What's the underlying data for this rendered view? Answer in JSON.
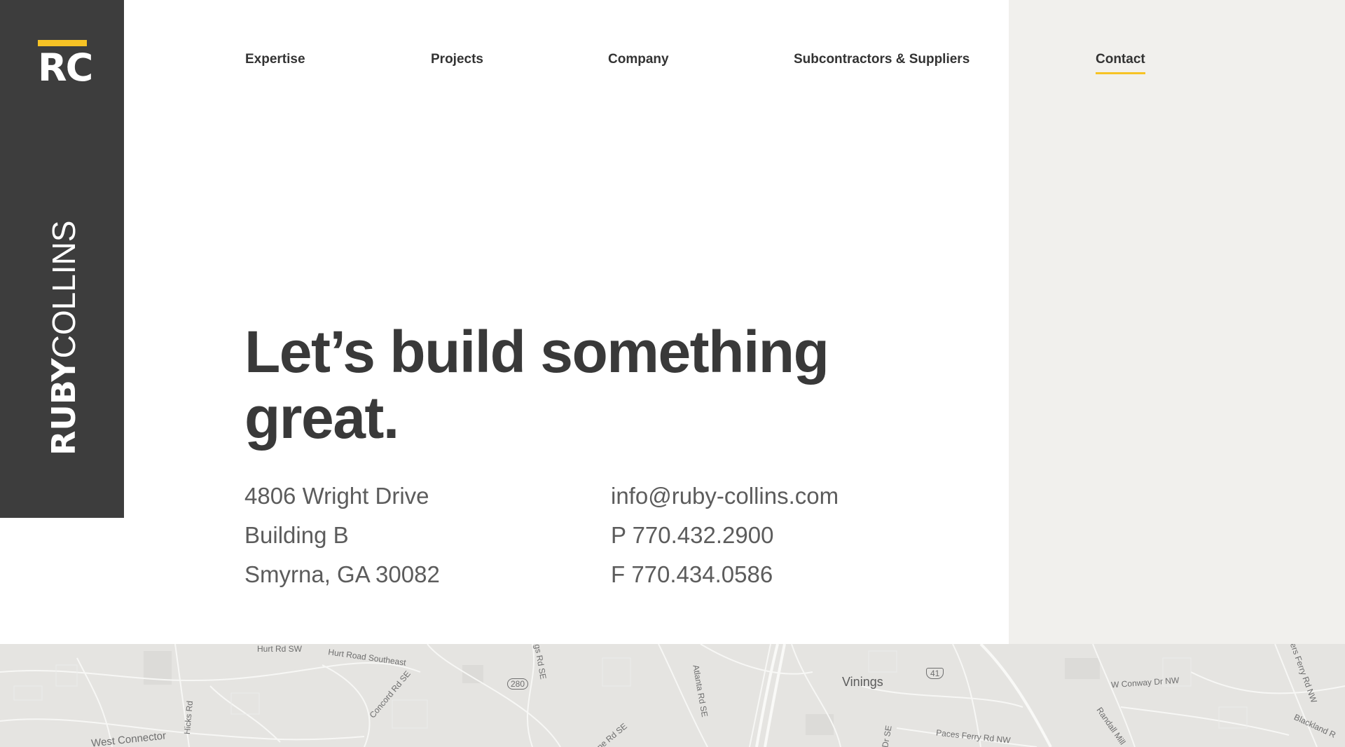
{
  "brand": {
    "logo_letters": "RC",
    "wordmark_bold": "RUBY",
    "wordmark_light": "COLLINS",
    "accent_color": "#f7c325",
    "sidebar_color": "#3d3d3d"
  },
  "nav": {
    "items": [
      {
        "label": "Expertise"
      },
      {
        "label": "Projects"
      },
      {
        "label": "Company"
      },
      {
        "label": "Subcontractors & Suppliers"
      },
      {
        "label": "Contact",
        "active": true
      }
    ]
  },
  "hero": {
    "headline_line1": "Let’s build something",
    "headline_line2": "great."
  },
  "address": {
    "line1": "4806 Wright Drive",
    "line2": "Building B",
    "line3": "Smyrna, GA 30082"
  },
  "contact": {
    "email": "info@ruby-collins.com",
    "phone": "P 770.432.2900",
    "fax": "F 770.434.0586"
  },
  "map": {
    "labels": {
      "hurt_rd_sw": "Hurt Rd SW",
      "hurt_road_se": "Hurt Road Southeast",
      "concord_rd": "Concord Rd SE",
      "hicks_rd": "Hicks Rd",
      "west_connector": "West Connector",
      "kings_rd": "ngs Rd SE",
      "route_280": "280",
      "atlanta_rd": "Atlanta Rd SE",
      "ne_rd": "ne Rd SE",
      "vinings": "Vinings",
      "route_41": "41",
      "dr_se": "Dr SE",
      "paces_ferry": "Paces Ferry Rd NW",
      "w_conway": "W Conway Dr NW",
      "randall_mill": "Randall Mill",
      "powers_ferry": "wers Ferry Rd NW",
      "blackland": "Blackland R"
    }
  }
}
